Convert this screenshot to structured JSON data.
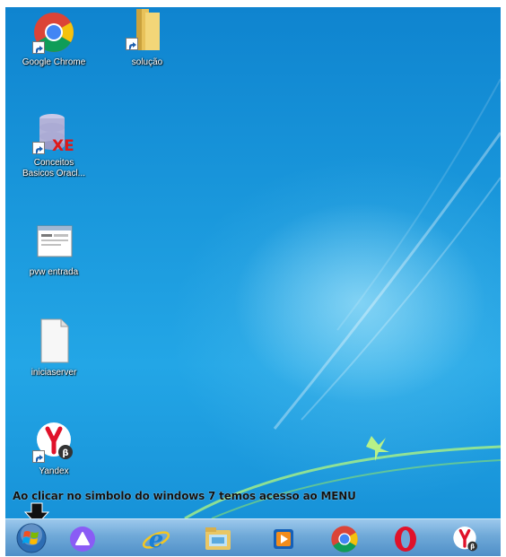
{
  "desktop": {
    "icons": [
      {
        "label": "Google Chrome",
        "icon": "chrome-icon"
      },
      {
        "label": "solução",
        "icon": "folder-icon"
      },
      {
        "label": "Conceitos Basicos Oracl...",
        "icon": "database-xe-icon"
      },
      {
        "label": "pvw entrada",
        "icon": "window-screenshot-icon"
      },
      {
        "label": "iniciaserver",
        "icon": "file-icon"
      },
      {
        "label": "Yandex",
        "icon": "yandex-browser-icon"
      }
    ],
    "caption": "Ao clicar no simbolo do windows 7 temos acesso ao MENU"
  },
  "taskbar": {
    "items": [
      {
        "name": "start-button",
        "icon": "windows-orb-icon"
      },
      {
        "name": "alice-app",
        "icon": "alice-icon"
      },
      {
        "name": "internet-explorer",
        "icon": "internet-explorer-icon"
      },
      {
        "name": "file-explorer",
        "icon": "folder-library-icon"
      },
      {
        "name": "media-player",
        "icon": "media-player-icon"
      },
      {
        "name": "google-chrome",
        "icon": "chrome-icon"
      },
      {
        "name": "opera",
        "icon": "opera-icon"
      },
      {
        "name": "yandex-browser",
        "icon": "yandex-browser-icon"
      }
    ]
  },
  "colors": {
    "desktop_blue": "#1a98dc",
    "taskbar_blue": "#6fa9d8",
    "chrome_red": "#db4437",
    "chrome_yellow": "#f4c20d",
    "chrome_green": "#0f9d58",
    "chrome_blue": "#4285f4",
    "opera_red": "#e0122a",
    "alice_purple": "#8a5cf5"
  }
}
